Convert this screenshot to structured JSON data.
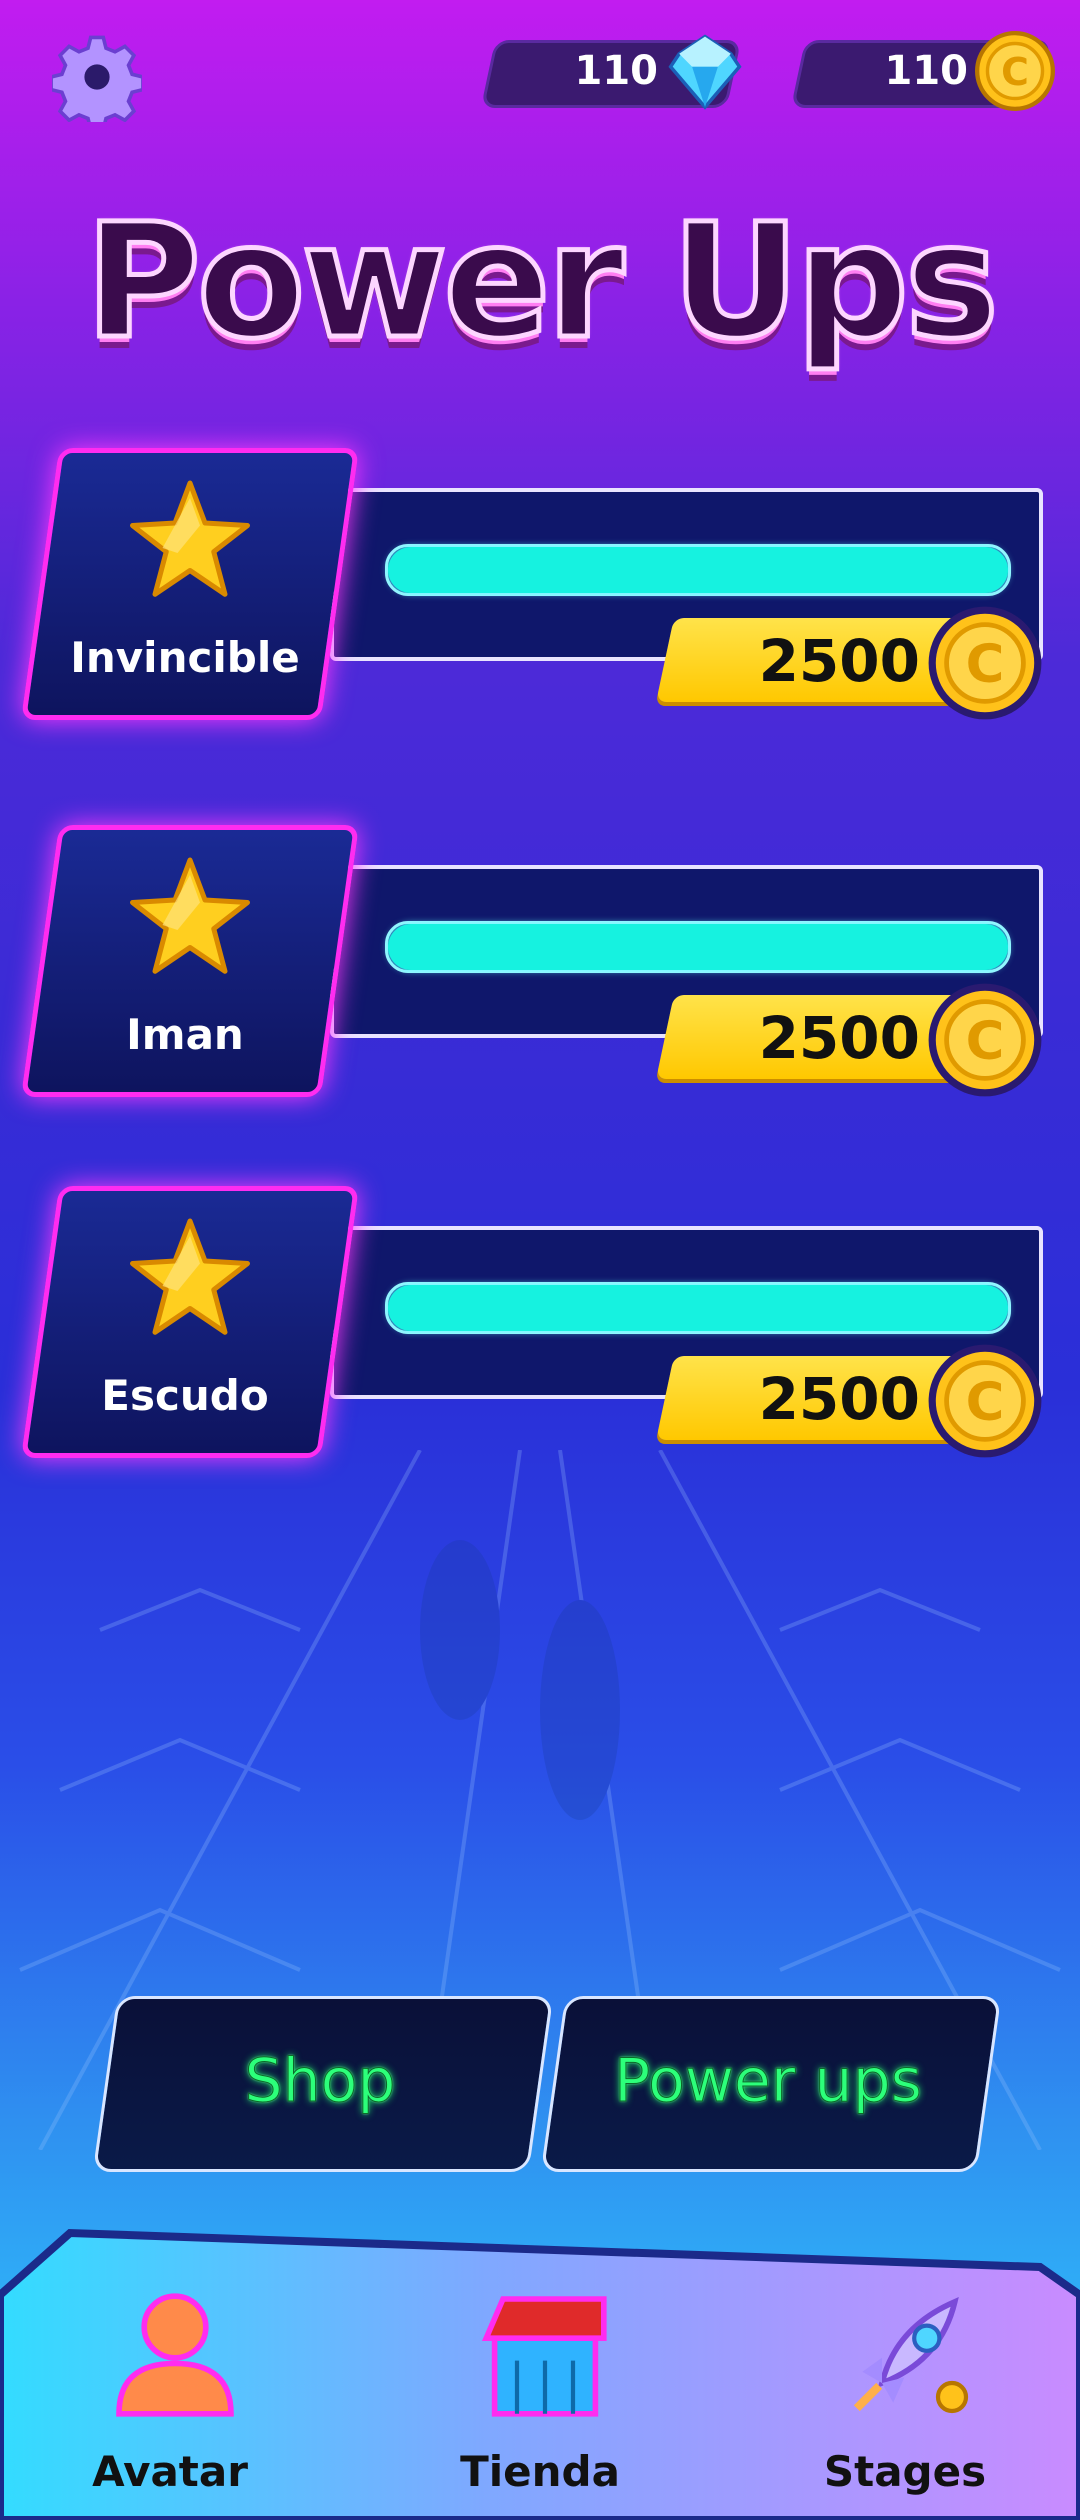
{
  "top_bar": {
    "settings_icon": "gear-icon",
    "gems": {
      "value": "110",
      "icon": "diamond-icon"
    },
    "coins": {
      "value": "110",
      "icon": "coin-icon"
    }
  },
  "title": "Power Ups",
  "power_ups": [
    {
      "name": "Invincible",
      "price": "2500",
      "icon": "star-icon",
      "progress": 1.0
    },
    {
      "name": "Iman",
      "price": "2500",
      "icon": "star-icon",
      "progress": 1.0
    },
    {
      "name": "Escudo",
      "price": "2500",
      "icon": "star-icon",
      "progress": 1.0
    }
  ],
  "tabs": {
    "shop": "Shop",
    "power_ups": "Power ups"
  },
  "bottom_nav": [
    {
      "label": "Avatar",
      "icon": "avatar-icon"
    },
    {
      "label": "Tienda",
      "icon": "store-icon"
    },
    {
      "label": "Stages",
      "icon": "rocket-icon"
    }
  ],
  "colors": {
    "accent_magenta": "#ff2cf0",
    "progress_cyan": "#16f2e0",
    "price_yellow": "#ffd21a",
    "tab_text_green": "#2cff7a"
  }
}
